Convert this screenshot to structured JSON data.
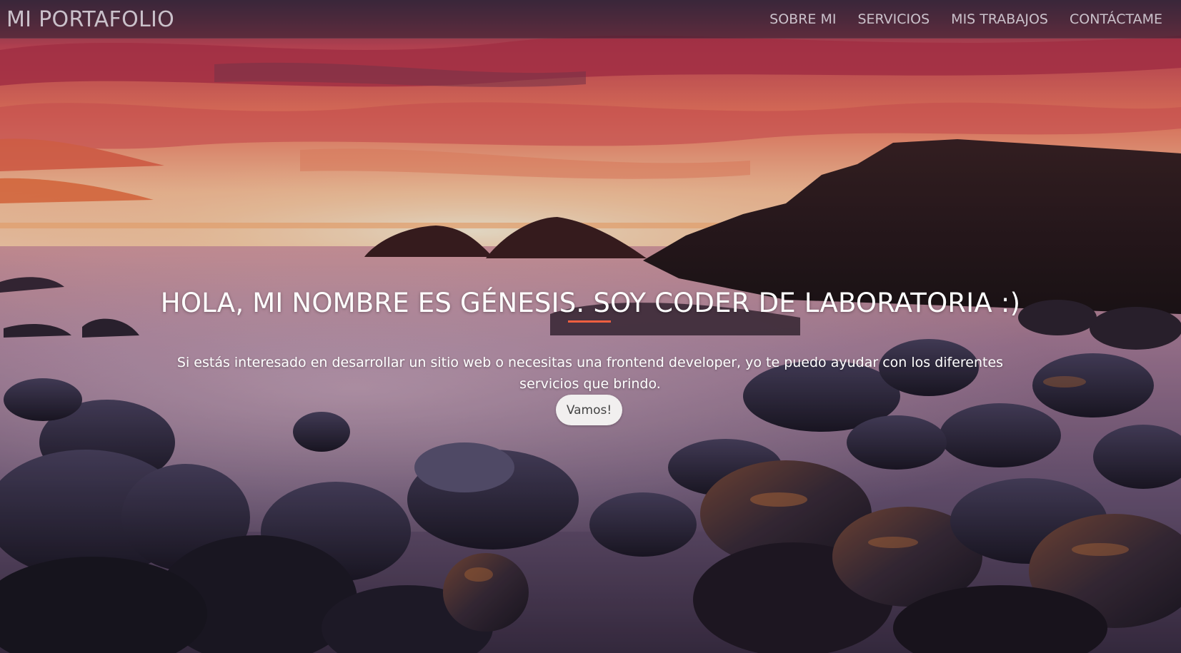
{
  "navbar": {
    "brand": "MI PORTAFOLIO",
    "links": [
      {
        "label": "SOBRE MI"
      },
      {
        "label": "SERVICIOS"
      },
      {
        "label": "MIS TRABAJOS"
      },
      {
        "label": "CONTÁCTAME"
      }
    ]
  },
  "hero": {
    "title": "HOLA, MI NOMBRE ES GÉNESIS. SOY CODER DE LABORATORIA :)",
    "text": "Si estás interesado en desarrollar un sitio web o necesitas una frontend developer, yo te puedo ayudar con los diferentes servicios que brindo.",
    "button_label": "Vamos!",
    "background_image": "sunset-rocky-coast-photo"
  },
  "colors": {
    "accent": "#f05f40",
    "button_bg": "#f1efef",
    "text": "#ffffff",
    "nav_text": "#e1dce4"
  }
}
